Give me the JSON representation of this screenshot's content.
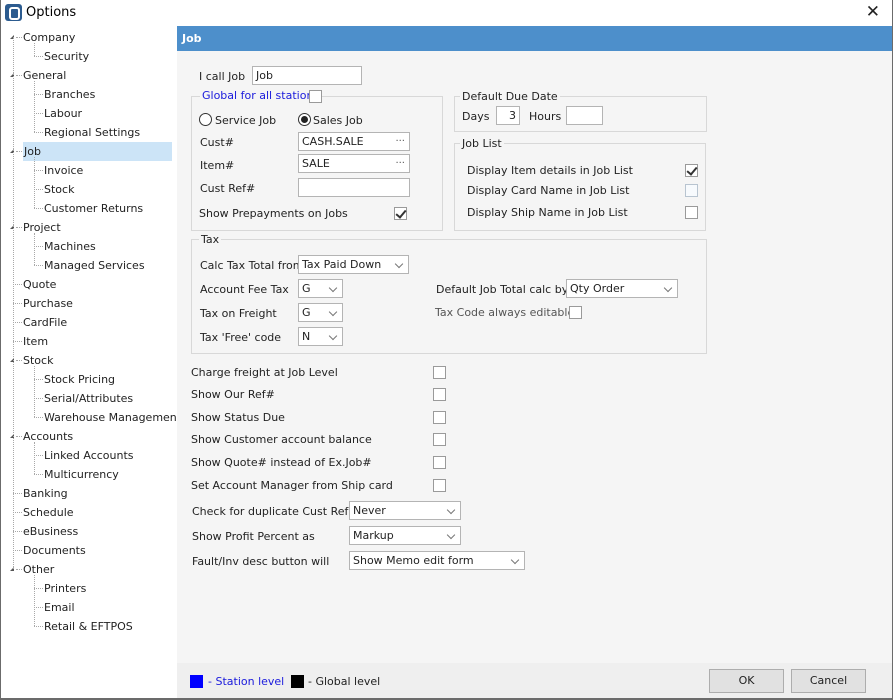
{
  "window": {
    "title": "Options",
    "close_label": "✕"
  },
  "sidebar": {
    "items": [
      {
        "label": "Company",
        "level": 0,
        "expanded": true
      },
      {
        "label": "Security",
        "level": 1
      },
      {
        "label": "General",
        "level": 0,
        "expanded": true
      },
      {
        "label": "Branches",
        "level": 1
      },
      {
        "label": "Labour",
        "level": 1
      },
      {
        "label": "Regional Settings",
        "level": 1
      },
      {
        "label": "Job",
        "level": 0,
        "expanded": true,
        "selected": true
      },
      {
        "label": "Invoice",
        "level": 1
      },
      {
        "label": "Stock",
        "level": 1
      },
      {
        "label": "Customer Returns",
        "level": 1
      },
      {
        "label": "Project",
        "level": 0,
        "expanded": true
      },
      {
        "label": "Machines",
        "level": 1
      },
      {
        "label": "Managed Services",
        "level": 1
      },
      {
        "label": "Quote",
        "level": 0
      },
      {
        "label": "Purchase",
        "level": 0
      },
      {
        "label": "CardFile",
        "level": 0
      },
      {
        "label": "Item",
        "level": 0
      },
      {
        "label": "Stock",
        "level": 0,
        "expanded": true
      },
      {
        "label": "Stock Pricing",
        "level": 1
      },
      {
        "label": "Serial/Attributes",
        "level": 1
      },
      {
        "label": "Warehouse Management",
        "level": 1
      },
      {
        "label": "Accounts",
        "level": 0,
        "expanded": true
      },
      {
        "label": "Linked Accounts",
        "level": 1
      },
      {
        "label": "Multicurrency",
        "level": 1
      },
      {
        "label": "Banking",
        "level": 0
      },
      {
        "label": "Schedule",
        "level": 0
      },
      {
        "label": "eBusiness",
        "level": 0
      },
      {
        "label": "Documents",
        "level": 0
      },
      {
        "label": "Other",
        "level": 0,
        "expanded": true
      },
      {
        "label": "Printers",
        "level": 1
      },
      {
        "label": "Email",
        "level": 1
      },
      {
        "label": "Retail & EFTPOS",
        "level": 1
      }
    ]
  },
  "page": {
    "header": "Job",
    "i_call_job": {
      "label": "I call Job",
      "value": "Job"
    },
    "global_group": {
      "legend": "Global for all stations",
      "global_checked": false,
      "radio_service": "Service Job",
      "radio_sales": "Sales Job",
      "selected": "Sales Job",
      "cust": {
        "label": "Cust#",
        "value": "CASH.SALE",
        "ellipsis": "···"
      },
      "item": {
        "label": "Item#",
        "value": "SALE",
        "ellipsis": "···"
      },
      "cust_ref": {
        "label": "Cust Ref#",
        "value": ""
      },
      "prepayments": {
        "label": "Show Prepayments on Jobs",
        "checked": true
      }
    },
    "due_date": {
      "legend": "Default Due Date",
      "days_label": "Days",
      "days_value": "3",
      "hours_label": "Hours",
      "hours_value": ""
    },
    "job_list": {
      "legend": "Job List",
      "options": [
        {
          "label": "Display Item details in Job List",
          "checked": true
        },
        {
          "label": "Display Card Name in Job List",
          "checked": false
        },
        {
          "label": "Display Ship Name in Job List",
          "checked": false
        }
      ]
    },
    "tax": {
      "legend": "Tax",
      "calc_tax_total": {
        "label": "Calc Tax Total from",
        "value": "Tax Paid Down"
      },
      "account_fee_tax": {
        "label": "Account Fee Tax",
        "value": "G"
      },
      "tax_on_freight": {
        "label": "Tax on Freight",
        "value": "G"
      },
      "tax_free_code": {
        "label": "Tax 'Free' code",
        "value": "N"
      },
      "default_job_total": {
        "label": "Default Job Total calc by",
        "value": "Qty Order"
      },
      "tax_code_editable": {
        "label": "Tax Code always editable",
        "checked": false
      }
    },
    "options": [
      {
        "label": "Charge freight at Job Level",
        "checked": false
      },
      {
        "label": "Show Our Ref#",
        "checked": false
      },
      {
        "label": "Show Status Due",
        "checked": false
      },
      {
        "label": "Show Customer account balance",
        "checked": false
      },
      {
        "label": "Show Quote# instead of Ex.Job#",
        "checked": false
      },
      {
        "label": "Set Account Manager from Ship card",
        "checked": false
      }
    ],
    "dup_cust_ref": {
      "label": "Check for duplicate Cust Ref#",
      "value": "Never"
    },
    "profit_percent": {
      "label": "Show Profit Percent as",
      "value": "Markup"
    },
    "fault_inv_desc": {
      "label": "Fault/Inv desc button will",
      "value": "Show Memo edit form"
    }
  },
  "footer": {
    "station_level": "- Station level",
    "global_level": "- Global level",
    "station_color": "#0000ff",
    "global_color": "#000000",
    "ok": "OK",
    "cancel": "Cancel"
  }
}
